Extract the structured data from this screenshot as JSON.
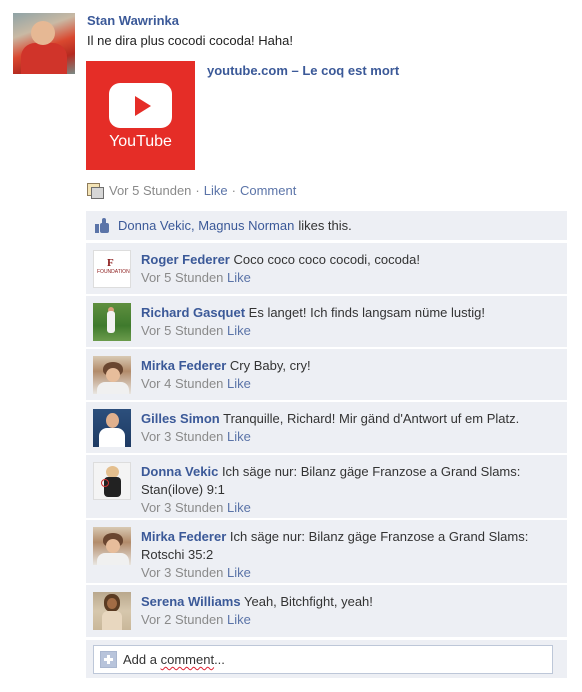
{
  "post": {
    "author": "Stan Wawrinka",
    "text": "Il ne dira plus cocodi cocoda! Haha!",
    "link_title": "youtube.com – Le coq est mort",
    "thumbnail_label": "YouTube",
    "time": "Vor 5 Stunden",
    "like_label": "Like",
    "comment_label": "Comment",
    "separator": "·"
  },
  "likes": {
    "names": "Donna Vekic, Magnus Norman",
    "rest": "likes this."
  },
  "comments": [
    {
      "author": "Roger Federer",
      "text": "Coco coco coco cocodi, cocoda!",
      "time": "Vor 5 Stunden",
      "like": "Like",
      "avatar": "federer-foundation-logo"
    },
    {
      "author": "Richard Gasquet",
      "text": "Es langet! Ich finds langsam nüme lustig!",
      "time": "Vor 5 Stunden",
      "like": "Like",
      "avatar": "tennis-player-photo"
    },
    {
      "author": "Mirka Federer",
      "text": "Cry Baby, cry!",
      "time": "Vor 4 Stunden",
      "like": "Like",
      "avatar": "woman-portrait"
    },
    {
      "author": "Gilles Simon",
      "text": "Tranquille, Richard! Mir gänd d'Antwort uf em Platz.",
      "time": "Vor 3 Stunden",
      "like": "Like",
      "avatar": "man-portrait"
    },
    {
      "author": "Donna Vekic",
      "text": "Ich säge nur: Bilanz gäge Franzose a Grand Slams: Stan(ilove) 9:1",
      "time": "Vor 3 Stunden",
      "like": "Like",
      "avatar": "woman-with-racket"
    },
    {
      "author": "Mirka Federer",
      "text": "Ich säge nur: Bilanz gäge Franzose a Grand Slams: Rotschi 35:2",
      "time": "Vor 3 Stunden",
      "like": "Like",
      "avatar": "woman-portrait"
    },
    {
      "author": "Serena Williams",
      "text": "Yeah, Bitchfight, yeah!",
      "time": "Vor 2 Stunden",
      "like": "Like",
      "avatar": "woman-portrait"
    }
  ],
  "add_comment": {
    "prefix": "Add a ",
    "squiggle_word": "comment",
    "suffix": "..."
  },
  "colors": {
    "link": "#3b5998",
    "panel": "#edeff4",
    "youtube_red": "#e52d27"
  }
}
